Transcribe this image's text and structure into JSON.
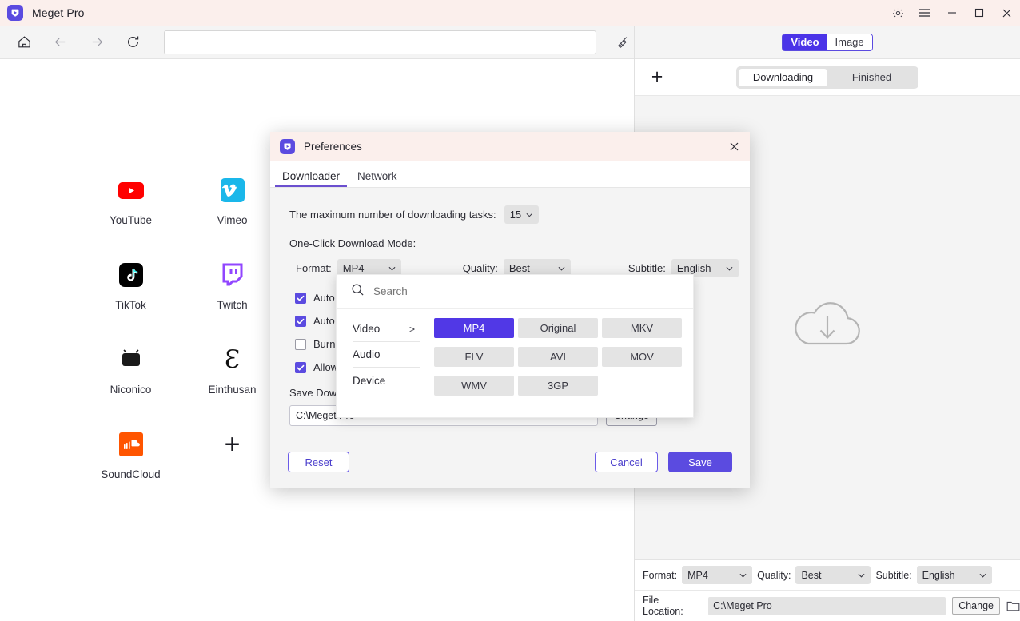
{
  "app": {
    "title": "Meget Pro",
    "logo_icon": "play-logo-icon",
    "accent": "#5B4BE0",
    "titlebar_bg": "#fbefec"
  },
  "window_controls": [
    {
      "name": "settings-button",
      "icon": "gear-icon"
    },
    {
      "name": "menu-button",
      "icon": "hamburger-icon"
    },
    {
      "name": "minimize-button",
      "icon": "minimize-icon"
    },
    {
      "name": "maximize-button",
      "icon": "maximize-icon"
    },
    {
      "name": "close-button",
      "icon": "close-icon"
    }
  ],
  "navbar": {
    "home_icon": "home-icon",
    "back_icon": "arrow-left-icon",
    "forward_icon": "arrow-right-icon",
    "reload_icon": "reload-icon",
    "url_value": "",
    "url_placeholder": "",
    "clean_icon": "broom-icon"
  },
  "sites": [
    {
      "label": "YouTube",
      "icon": "youtube-icon"
    },
    {
      "label": "Vimeo",
      "icon": "vimeo-icon"
    },
    {
      "label": "",
      "icon": ""
    },
    {
      "label": "",
      "icon": ""
    },
    {
      "label": "",
      "icon": ""
    },
    {
      "label": "TikTok",
      "icon": "tiktok-icon"
    },
    {
      "label": "Twitch",
      "icon": "twitch-icon"
    },
    {
      "label": "",
      "icon": ""
    },
    {
      "label": "",
      "icon": ""
    },
    {
      "label": "",
      "icon": ""
    },
    {
      "label": "Niconico",
      "icon": "niconico-icon"
    },
    {
      "label": "Einthusan",
      "icon": "einthusan-icon"
    },
    {
      "label": "",
      "icon": ""
    },
    {
      "label": "",
      "icon": ""
    },
    {
      "label": "",
      "icon": ""
    },
    {
      "label": "SoundCloud",
      "icon": "soundcloud-icon"
    },
    {
      "label": "",
      "icon": "add-site-icon"
    }
  ],
  "right_panel": {
    "mode_tabs": [
      {
        "label": "Video",
        "active": true
      },
      {
        "label": "Image",
        "active": false
      }
    ],
    "add_icon": "plus-icon",
    "status_tabs": [
      {
        "label": "Downloading",
        "active": true
      },
      {
        "label": "Finished",
        "active": false
      }
    ],
    "empty_icon": "cloud-download-icon",
    "footer": {
      "format_label": "Format:",
      "format_value": "MP4",
      "quality_label": "Quality:",
      "quality_value": "Best",
      "subtitle_label": "Subtitle:",
      "subtitle_value": "English",
      "file_location_label": "File Location:",
      "file_location_value": "C:\\Meget Pro",
      "change_label": "Change",
      "folder_icon": "folder-icon"
    }
  },
  "dialog": {
    "title": "Preferences",
    "logo_icon": "play-logo-icon",
    "close_icon": "close-icon",
    "tabs": [
      {
        "label": "Downloader",
        "active": true
      },
      {
        "label": "Network",
        "active": false
      }
    ],
    "max_tasks_label": "The maximum number of downloading tasks:",
    "max_tasks_value": "15",
    "oneclick_label": "One-Click Download Mode:",
    "format_label": "Format:",
    "format_value": "MP4",
    "quality_label": "Quality:",
    "quality_value": "Best",
    "subtitle_label": "Subtitle:",
    "subtitle_value": "English",
    "checkboxes": [
      {
        "label": "Auto d",
        "checked": true
      },
      {
        "label": "Auto re",
        "checked": true
      },
      {
        "label": "Burn th",
        "checked": false
      },
      {
        "label": "Allow t",
        "checked": true
      }
    ],
    "save_dir_label": "Save Down",
    "save_dir_value": "C:\\Meget Pro",
    "change_label": "Change",
    "reset_label": "Reset",
    "cancel_label": "Cancel",
    "save_label": "Save"
  },
  "format_popup": {
    "search_placeholder": "Search",
    "search_icon": "search-icon",
    "categories": [
      {
        "label": "Video",
        "active": true,
        "arrow": ">"
      },
      {
        "label": "Audio",
        "active": false,
        "arrow": ""
      },
      {
        "label": "Device",
        "active": false,
        "arrow": ""
      }
    ],
    "options": [
      {
        "label": "MP4",
        "selected": true
      },
      {
        "label": "Original",
        "selected": false
      },
      {
        "label": "MKV",
        "selected": false
      },
      {
        "label": "FLV",
        "selected": false
      },
      {
        "label": "AVI",
        "selected": false
      },
      {
        "label": "MOV",
        "selected": false
      },
      {
        "label": "WMV",
        "selected": false
      },
      {
        "label": "3GP",
        "selected": false
      }
    ]
  }
}
